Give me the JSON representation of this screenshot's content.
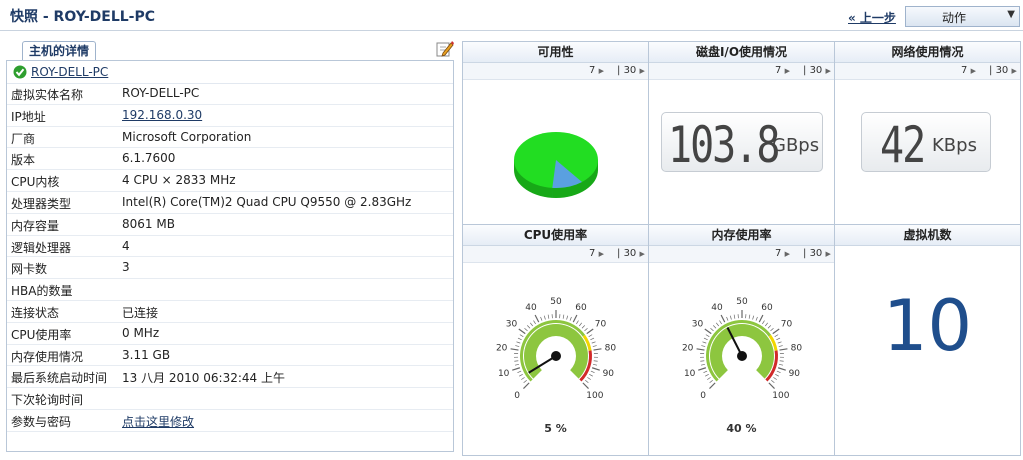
{
  "page": {
    "title": "快照 - ROY-DELL-PC",
    "back_label": "« 上一步",
    "action_label": "动作"
  },
  "host_panel": {
    "tab_label": "主机的详情",
    "host_name": "ROY-DELL-PC",
    "rows": [
      {
        "label": "虚拟实体名称",
        "value": "ROY-DELL-PC",
        "link": false
      },
      {
        "label": "IP地址",
        "value": "192.168.0.30",
        "link": true
      },
      {
        "label": "厂商",
        "value": "Microsoft Corporation",
        "link": false
      },
      {
        "label": "版本",
        "value": "6.1.7600",
        "link": false
      },
      {
        "label": "CPU内核",
        "value": "4 CPU × 2833 MHz",
        "link": false
      },
      {
        "label": "处理器类型",
        "value": "Intel(R) Core(TM)2 Quad CPU Q9550 @ 2.83GHz",
        "link": false
      },
      {
        "label": "内存容量",
        "value": "8061 MB",
        "link": false
      },
      {
        "label": "逻辑处理器",
        "value": "4",
        "link": false
      },
      {
        "label": "网卡数",
        "value": "3",
        "link": false
      },
      {
        "label": "HBA的数量",
        "value": "",
        "link": false
      },
      {
        "label": "连接状态",
        "value": "已连接",
        "link": false
      },
      {
        "label": "CPU使用率",
        "value": "0 MHz",
        "link": false
      },
      {
        "label": "内存使用情况",
        "value": "3.11 GB",
        "link": false
      },
      {
        "label": "最后系统启动时间",
        "value": "13 八月 2010 06:32:44 上午",
        "link": false
      },
      {
        "label": "下次轮询时间",
        "value": "",
        "link": false
      },
      {
        "label": "参数与密码",
        "value": "点击这里修改",
        "link": true
      }
    ]
  },
  "dashboard": {
    "tool_7": "7",
    "tool_30": "30",
    "availability": {
      "title": "可用性",
      "available_fraction": 0.88,
      "colors": {
        "up": "#22dd22",
        "down": "#5aa0e0"
      }
    },
    "disk_io": {
      "title": "磁盘I/O使用情况",
      "value": "103.8",
      "unit": "GBps"
    },
    "network": {
      "title": "网络使用情况",
      "value": "42",
      "unit": "KBps"
    },
    "cpu": {
      "title": "CPU使用率",
      "percent": 5,
      "label": "5 %"
    },
    "memory": {
      "title": "内存使用率",
      "percent": 40,
      "label": "40 %"
    },
    "vms": {
      "title": "虚拟机数",
      "count": "10"
    },
    "gauge_ticks": [
      "0",
      "10",
      "20",
      "30",
      "40",
      "50",
      "60",
      "70",
      "80",
      "90",
      "100"
    ]
  }
}
